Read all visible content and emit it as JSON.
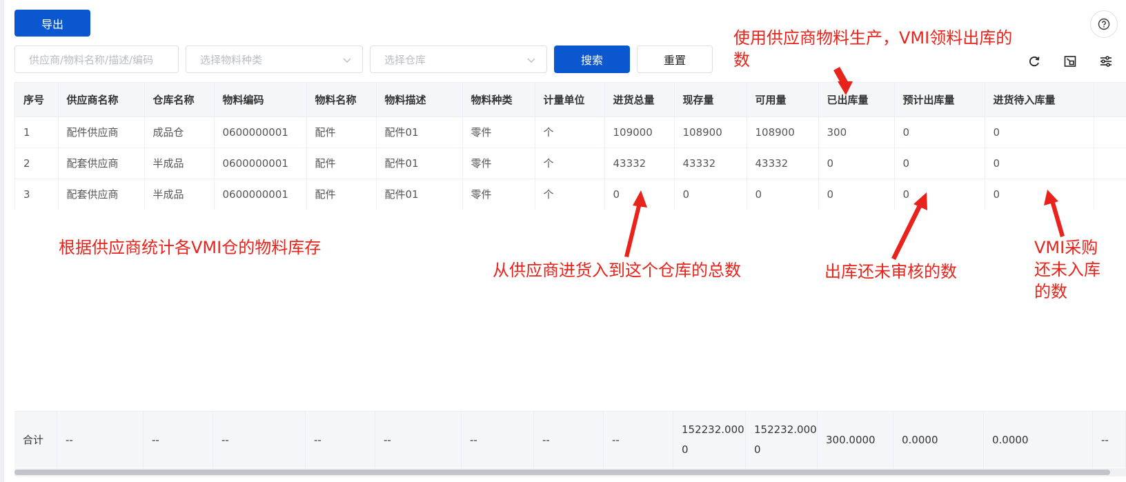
{
  "toolbar": {
    "export_label": "导出",
    "search_placeholder": "供应商/物料名称/描述/编码",
    "type_placeholder": "选择物料种类",
    "warehouse_placeholder": "选择仓库",
    "search_label": "搜索",
    "reset_label": "重置"
  },
  "icons": {
    "help": "help-icon",
    "refresh": "refresh-icon",
    "fullscreen": "fullscreen-icon",
    "settings": "column-settings-icon"
  },
  "colors": {
    "primary": "#0b57d0",
    "annotation": "#e8231b",
    "header_bg": "#f5f6f8"
  },
  "table": {
    "columns": [
      "序号",
      "供应商名称",
      "仓库名称",
      "物料编码",
      "物料名称",
      "物料描述",
      "物料种类",
      "计量单位",
      "进货总量",
      "现存量",
      "可用量",
      "已出库量",
      "预计出库量",
      "进货待入库量",
      ""
    ],
    "rows": [
      [
        "1",
        "配件供应商",
        "成品仓",
        "0600000001",
        "配件",
        "配件01",
        "零件",
        "个",
        "109000",
        "108900",
        "108900",
        "300",
        "0",
        "0",
        ""
      ],
      [
        "2",
        "配套供应商",
        "半成品",
        "0600000001",
        "配件",
        "配件01",
        "零件",
        "个",
        "43332",
        "43332",
        "43332",
        "0",
        "0",
        "0",
        ""
      ],
      [
        "3",
        "配套供应商",
        "半成品",
        "0600000001",
        "配件",
        "配件01",
        "零件",
        "个",
        "0",
        "0",
        "0",
        "0",
        "0",
        "0",
        ""
      ]
    ],
    "summary": [
      "合计",
      "--",
      "--",
      "--",
      "--",
      "--",
      "--",
      "--",
      "--",
      "152232.0000",
      "152232.0000",
      "300.0000",
      "0.0000",
      "0.0000",
      "--"
    ]
  },
  "annotations": {
    "issued": "使用供应商物料生产，VMI领料出库的数",
    "inventory": "根据供应商统计各VMI仓的物料库存",
    "total_in": "从供应商进货入到这个仓库的总数",
    "pending_out": "出库还未审核的数",
    "pending_in": "VMI采购还未入库的数"
  }
}
